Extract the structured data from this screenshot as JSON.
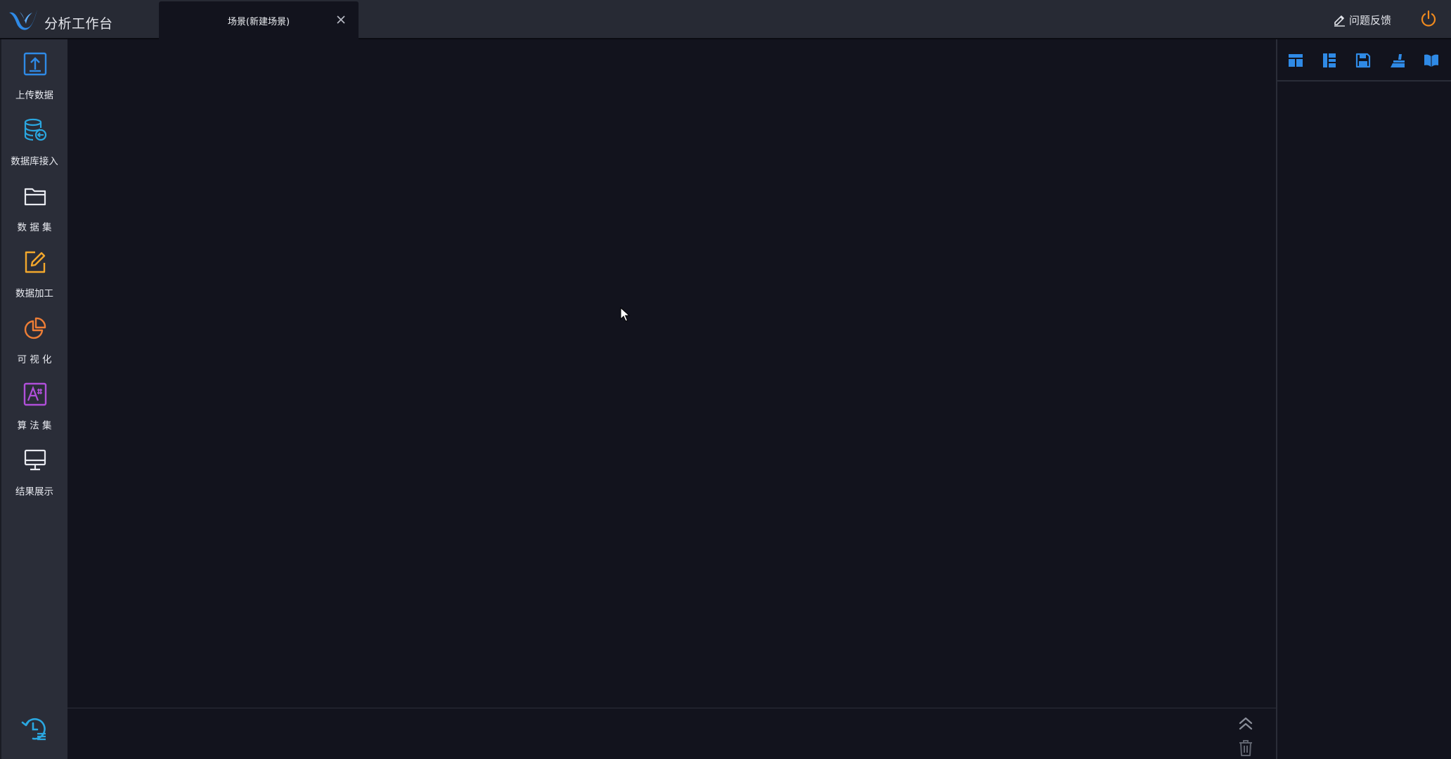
{
  "app": {
    "title": "分析工作台",
    "accent_color": "#2f8ae6"
  },
  "tabs": [
    {
      "label": "场景(新建场景)",
      "active": true
    }
  ],
  "header": {
    "feedback_label": "问题反馈",
    "feedback_icon": "pencil-icon",
    "power_icon": "power-icon",
    "power_color": "#f08a1e"
  },
  "sidebar": {
    "items": [
      {
        "label": "上传数据",
        "icon": "upload-icon",
        "color": "#2f8ae6"
      },
      {
        "label": "数据库接入",
        "icon": "database-icon",
        "color": "#2aa7e0"
      },
      {
        "label": "数 据 集",
        "icon": "folder-icon",
        "color": "#e8eaf0"
      },
      {
        "label": "数据加工",
        "icon": "edit-icon",
        "color": "#f2a72c"
      },
      {
        "label": "可 视 化",
        "icon": "pie-chart-icon",
        "color": "#ee7e36"
      },
      {
        "label": "算 法 集",
        "icon": "algorithm-icon",
        "color": "#b04fd9"
      },
      {
        "label": "结果展示",
        "icon": "monitor-icon",
        "color": "#e8eaf0"
      }
    ],
    "history_icon": "history-icon"
  },
  "right_toolbar": {
    "buttons": [
      {
        "icon": "layout-top-icon"
      },
      {
        "icon": "layout-left-icon"
      },
      {
        "icon": "save-icon"
      },
      {
        "icon": "clear-brush-icon"
      },
      {
        "icon": "book-icon"
      }
    ],
    "color": "#2f8ae6"
  },
  "bottom_panel": {
    "collapse_icon": "double-chevron-up-icon",
    "trash_icon": "trash-icon"
  }
}
